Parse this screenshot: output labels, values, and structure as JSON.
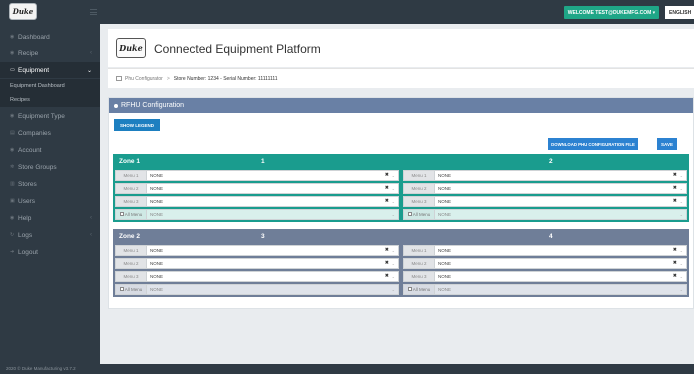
{
  "topbar": {
    "logo_text": "Duke",
    "welcome": "WELCOME TEST@DUKEMFG.COM ▾",
    "language": "ENGLISH"
  },
  "sidebar": {
    "items": [
      {
        "label": "Dashboard",
        "icon": "dashboard-icon"
      },
      {
        "label": "Recipe",
        "icon": "recipe-icon",
        "chevron": "‹"
      },
      {
        "label": "Equipment",
        "icon": "monitor-icon",
        "chevron": "⌄",
        "active": true
      },
      {
        "label": "Equipment Dashboard",
        "sub": true
      },
      {
        "label": "Recipes",
        "sub": true
      },
      {
        "label": "Equipment Type",
        "icon": "gear-icon"
      },
      {
        "label": "Companies",
        "icon": "building-icon"
      },
      {
        "label": "Account",
        "icon": "account-icon"
      },
      {
        "label": "Store Groups",
        "icon": "store-groups-icon"
      },
      {
        "label": "Stores",
        "icon": "stores-icon"
      },
      {
        "label": "Users",
        "icon": "users-icon"
      },
      {
        "label": "Help",
        "icon": "help-icon",
        "chevron": "‹"
      },
      {
        "label": "Logs",
        "icon": "logs-icon",
        "chevron": "‹"
      },
      {
        "label": "Logout",
        "icon": "logout-icon"
      }
    ]
  },
  "header": {
    "logo_text": "Duke",
    "title": "Connected Equipment Platform"
  },
  "breadcrumb": {
    "root": "Phu Configurator",
    "separator": ">",
    "details": "Store Number: 1234 - Serial Number: 11111111"
  },
  "card": {
    "title": "RFHU Configuration",
    "show_legend": "SHOW LEGEND",
    "download": "DOWNLOAD PHU CONFIGURATION FILE",
    "save": "SAVE"
  },
  "zones": [
    {
      "name": "Zone 1",
      "color": "#1a9c8e",
      "columns": [
        {
          "number": "1",
          "menus": [
            {
              "label": "Menu 1",
              "value": "NONE"
            },
            {
              "label": "Menu 2",
              "value": "NONE"
            },
            {
              "label": "Menu 3",
              "value": "NONE"
            }
          ],
          "all_label": "All Menu",
          "all_value": "NONE"
        },
        {
          "number": "2",
          "menus": [
            {
              "label": "Menu 1",
              "value": "NONE"
            },
            {
              "label": "Menu 2",
              "value": "NONE"
            },
            {
              "label": "Menu 3",
              "value": "NONE"
            }
          ],
          "all_label": "All Menu",
          "all_value": "NONE"
        }
      ]
    },
    {
      "name": "Zone 2",
      "color": "#6f7e98",
      "columns": [
        {
          "number": "3",
          "menus": [
            {
              "label": "Menu 1",
              "value": "NONE"
            },
            {
              "label": "Menu 2",
              "value": "NONE"
            },
            {
              "label": "Menu 3",
              "value": "NONE"
            }
          ],
          "all_label": "All Menu",
          "all_value": "NONE"
        },
        {
          "number": "4",
          "menus": [
            {
              "label": "Menu 1",
              "value": "NONE"
            },
            {
              "label": "Menu 2",
              "value": "NONE"
            },
            {
              "label": "Menu 3",
              "value": "NONE"
            }
          ],
          "all_label": "All Menu",
          "all_value": "NONE"
        }
      ]
    }
  ],
  "select_glyphs": {
    "clear": "✖",
    "caret": "⌄"
  },
  "footer": {
    "text": "2020 © Duke Manufacturing v3.7.2"
  }
}
